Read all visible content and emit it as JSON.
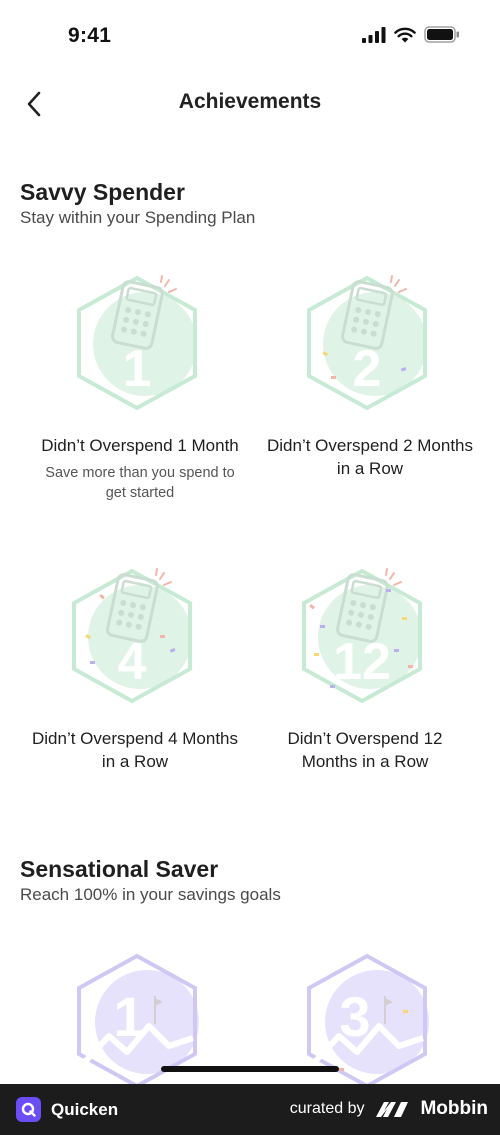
{
  "status_bar": {
    "time": "9:41"
  },
  "nav": {
    "title": "Achievements"
  },
  "sections": [
    {
      "title": "Savvy Spender",
      "subtitle": "Stay within your Spending Plan",
      "badges": [
        {
          "number": "1",
          "title": "Didn’t Overspend 1 Month",
          "description": "Save more than you spend to get started",
          "theme": "green"
        },
        {
          "number": "2",
          "title": "Didn’t Overspend 2 Months in a Row",
          "description": "",
          "theme": "green"
        },
        {
          "number": "4",
          "title": "Didn’t Overspend 4 Months in a Row",
          "description": "",
          "theme": "green"
        },
        {
          "number": "12",
          "title": "Didn’t Overspend 12 Months in a Row",
          "description": "",
          "theme": "green"
        }
      ]
    },
    {
      "title": "Sensational Saver",
      "subtitle": "Reach 100% in your savings goals",
      "badges": [
        {
          "number": "1",
          "theme": "purple"
        },
        {
          "number": "3",
          "theme": "purple"
        }
      ]
    }
  ],
  "footer": {
    "app_name": "Quicken",
    "curated_by": "curated by",
    "brand": "Mobbin"
  },
  "colors": {
    "green_fill": "#dff3e6",
    "green_stroke": "#c6ead3",
    "purple_fill": "#e6e2fb",
    "purple_stroke": "#cfc8f4",
    "footer_bg": "#1c1c1c",
    "quicken_purple": "#6a4df5"
  },
  "icons": [
    "back-chevron-icon",
    "signal-icon",
    "wifi-icon",
    "battery-icon",
    "calculator-icon",
    "mountain-icon",
    "quicken-logo-icon",
    "mobbin-logo-icon"
  ]
}
